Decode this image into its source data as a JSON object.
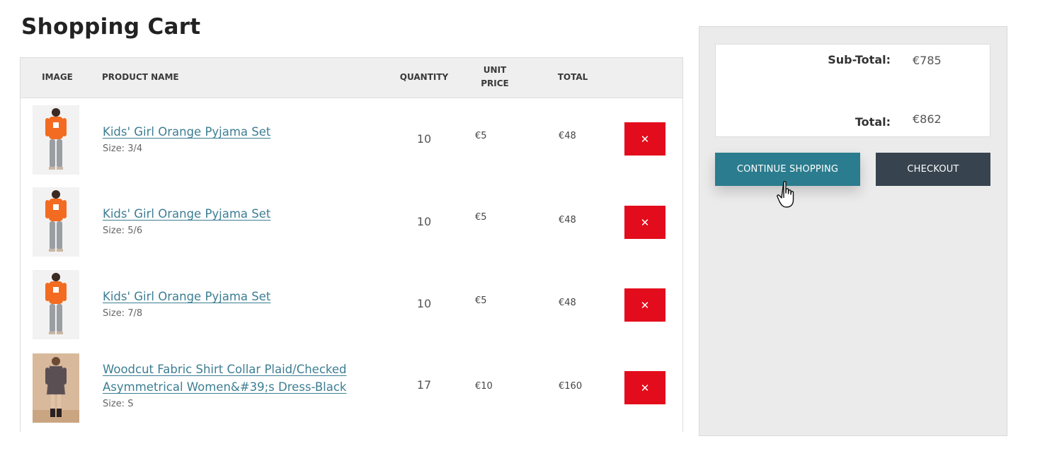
{
  "page": {
    "title": "Shopping Cart"
  },
  "table": {
    "headers": {
      "image": "IMAGE",
      "product_name": "PRODUCT NAME",
      "quantity": "QUANTITY",
      "unit_price_line1": "UNIT",
      "unit_price_line2": "PRICE",
      "total": "TOTAL"
    },
    "rows": [
      {
        "name": "Kids' Girl Orange Pyjama Set",
        "size": "Size: 3/4",
        "quantity": "10",
        "unit_price": "€5",
        "total": "€48",
        "remove_label": "✕",
        "image_icon": "orange-pyjama-thumbnail"
      },
      {
        "name": "Kids' Girl Orange Pyjama Set",
        "size": "Size: 5/6",
        "quantity": "10",
        "unit_price": "€5",
        "total": "€48",
        "remove_label": "✕",
        "image_icon": "orange-pyjama-thumbnail"
      },
      {
        "name": "Kids' Girl Orange Pyjama Set",
        "size": "Size: 7/8",
        "quantity": "10",
        "unit_price": "€5",
        "total": "€48",
        "remove_label": "✕",
        "image_icon": "orange-pyjama-thumbnail"
      },
      {
        "name_line1": "Woodcut Fabric Shirt Collar Plaid/Checked",
        "name_line2": "Asymmetrical Women&#39;s Dress-Black",
        "size": "Size: S",
        "quantity": "17",
        "unit_price": "€10",
        "total": "€160",
        "remove_label": "✕",
        "image_icon": "plaid-dress-thumbnail"
      }
    ]
  },
  "summary": {
    "subtotal_label": "Sub-Total:",
    "subtotal_value": "€785",
    "total_label": "Total:",
    "total_value": "€862",
    "continue_label": "CONTINUE SHOPPING",
    "checkout_label": "CHECKOUT"
  },
  "colors": {
    "accent": "#2b7c8e",
    "checkout": "#37434e",
    "remove": "#e30c1c",
    "link": "#3d7e93"
  },
  "cursor": {
    "icon": "hand-pointer-icon"
  }
}
